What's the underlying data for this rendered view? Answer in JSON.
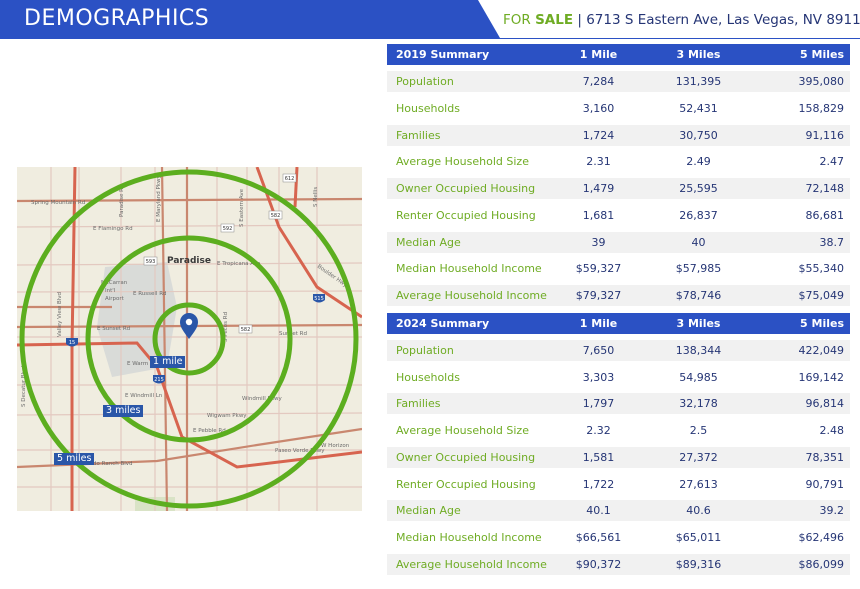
{
  "header": {
    "title": "DEMOGRAPHICS",
    "for_label": "FOR",
    "sale_label": "SALE",
    "address": "| 6713 S Eastern Ave, Las Vegas, NV 89119"
  },
  "colors": {
    "brand_blue": "#2b51c4",
    "accent_green": "#6fac24",
    "text_navy": "#253575",
    "row_alt": "#f1f1f1"
  },
  "map": {
    "place_label": "Paradise",
    "radius_labels": [
      "1 mile",
      "3 miles",
      "5 miles"
    ],
    "pin_icon": "map-pin-icon",
    "street_labels": [
      "Spring Mountain Rd",
      "E Flamingo Rd",
      "E Tropicana Ave",
      "E Russell Rd",
      "E Sunset Rd",
      "E Warm Springs Rd",
      "E Windmill Ln",
      "E Pebble Rd",
      "E Silverado Ranch Blvd",
      "W Horizon",
      "McCarran Int'l Airport",
      "Valley View Blvd",
      "S Decatur Blvd",
      "Wigwam Pkwy",
      "Windmill Pkwy",
      "Paseo Verde Pkwy",
      "Sunset Rd",
      "S Rainbow",
      "E Maryland Pkwy",
      "S Eastern Ave",
      "Boulder Hwy",
      "S Pecos Rd"
    ],
    "shields": [
      "612",
      "582",
      "593",
      "592",
      "15",
      "215",
      "515",
      "582",
      "215"
    ]
  },
  "summary_2019": {
    "header": [
      "2019 Summary",
      "1 Mile",
      "3 Miles",
      "5 Miles"
    ],
    "rows": [
      [
        "Population",
        "7,284",
        "131,395",
        "395,080"
      ],
      [
        "Households",
        "3,160",
        "52,431",
        "158,829"
      ],
      [
        "Families",
        "1,724",
        "30,750",
        "91,116"
      ],
      [
        "Average Household Size",
        "2.31",
        "2.49",
        "2.47"
      ],
      [
        "Owner Occupied Housing",
        "1,479",
        "25,595",
        "72,148"
      ],
      [
        "Renter Occupied Housing",
        "1,681",
        "26,837",
        "86,681"
      ],
      [
        "Median Age",
        "39",
        "40",
        "38.7"
      ],
      [
        "Median Household Income",
        "$59,327",
        "$57,985",
        "$55,340"
      ],
      [
        "Average Household Income",
        "$79,327",
        "$78,746",
        "$75,049"
      ]
    ]
  },
  "summary_2024": {
    "header": [
      "2024 Summary",
      "1 Mile",
      "3 Miles",
      "5 Miles"
    ],
    "rows": [
      [
        "Population",
        "7,650",
        "138,344",
        "422,049"
      ],
      [
        "Households",
        "3,303",
        "54,985",
        "169,142"
      ],
      [
        "Families",
        "1,797",
        "32,178",
        "96,814"
      ],
      [
        "Average Household Size",
        "2.32",
        "2.5",
        "2.48"
      ],
      [
        "Owner Occupied Housing",
        "1,581",
        "27,372",
        "78,351"
      ],
      [
        "Renter Occupied Housing",
        "1,722",
        "27,613",
        "90,791"
      ],
      [
        "Median Age",
        "40.1",
        "40.6",
        "39.2"
      ],
      [
        "Median Household Income",
        "$66,561",
        "$65,011",
        "$62,496"
      ],
      [
        "Average Household Income",
        "$90,372",
        "$89,316",
        "$86,099"
      ]
    ]
  }
}
